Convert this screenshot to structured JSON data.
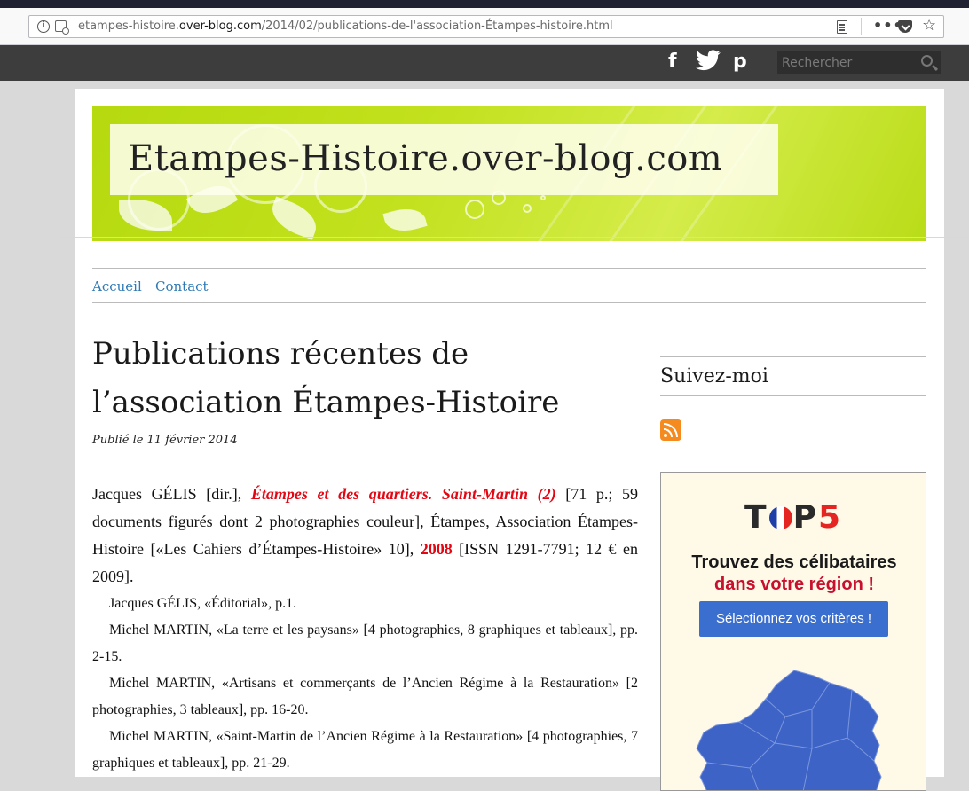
{
  "browser": {
    "url_prefix": "etampes-histoire.",
    "url_domain": "over-blog.com",
    "url_path": "/2014/02/publications-de-l'association-Étampes-histoire.html",
    "more_glyph": "•••",
    "star_glyph": "☆"
  },
  "topbar": {
    "facebook": "f",
    "twitter": "🐦",
    "pinterest": "p",
    "search_placeholder": "Rechercher"
  },
  "site": {
    "title": "Etampes-Histoire.over-blog.com"
  },
  "nav": {
    "items": [
      {
        "label": "Accueil"
      },
      {
        "label": "Contact"
      }
    ]
  },
  "post": {
    "title": "Publications récentes de l’association Étampes-Histoire",
    "date": "Publié le 11 février 2014",
    "main_pre": "Jacques GÉLIS [dir.], ",
    "main_red_title": "Étampes et des quartiers. Saint-Martin (2)",
    "main_mid": " [71 p.; 59 documents figurés dont 2 photographies couleur], Étampes, Association Étampes-Histoire [«Les Cahiers d’Étampes-Histoire» 10], ",
    "main_year": "2008",
    "main_post": " [ISSN 1291-7791; 12 € en 2009].",
    "subitems": [
      "Jacques GÉLIS, «Éditorial», p.1.",
      "Michel MARTIN, «La terre et les paysans» [4 photographies, 8 graphiques et tableaux], pp. 2-15.",
      "Michel MARTIN, «Artisans et commerçants de l’Ancien Régime à la Restauration» [2 photographies, 3 tableaux], pp. 16-20.",
      "Michel MARTIN, «Saint-Martin de l’Ancien Régime à la Restauration» [4 photographies, 7 graphiques et tableaux], pp. 21-29."
    ]
  },
  "sidebar": {
    "title": "Suivez-moi"
  },
  "ad": {
    "logo_t": "T",
    "logo_p": "P",
    "logo_5": "5",
    "line1": "Trouvez des célibataires",
    "line2": "dans votre région !",
    "button": "Sélectionnez vos critères !"
  }
}
